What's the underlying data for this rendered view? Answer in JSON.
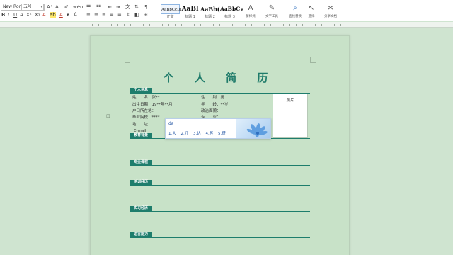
{
  "toolbar": {
    "font_name": "New Roma",
    "font_size": "五号",
    "styles": [
      {
        "preview": "AaBbCcDi",
        "label": "正文"
      },
      {
        "preview": "AaBl",
        "label": "标题 1"
      },
      {
        "preview": "AaBb(",
        "label": "标题 2"
      },
      {
        "preview": "AaBbC",
        "label": "标题 3"
      }
    ],
    "tools": [
      {
        "icon": "text-tools-icon",
        "glyph": "A",
        "label": "新样式"
      },
      {
        "icon": "text-toolbox-icon",
        "glyph": "✎",
        "label": "文字工具"
      },
      {
        "icon": "find-replace-icon",
        "glyph": "⌕",
        "label": "查找替换"
      },
      {
        "icon": "select-icon",
        "glyph": "↖",
        "label": "选择"
      },
      {
        "icon": "share-icon",
        "glyph": "⋈",
        "label": "分享文档"
      }
    ]
  },
  "document": {
    "title": "个 人 简 历",
    "photo_label": "照片",
    "sections": {
      "personal": "个人信息",
      "education": "教育背景",
      "courses": "专业课程",
      "awards": "培训经历",
      "practice": "实习经历",
      "language": "语言能力"
    },
    "fields": {
      "name": "姓　　名：张**",
      "gender": "性　　别：男",
      "birth": "出生日期：19**年**月",
      "age": "年　　龄：**岁",
      "hukou": "户口所在地：",
      "politics": "政治面貌：",
      "school": "毕业院校：****",
      "major": "专　　业：",
      "address": "地　　址：",
      "email": "E-mail："
    }
  },
  "ime": {
    "pinyin": "da",
    "candidates": [
      "1.大",
      "2.打",
      "3.达",
      "4.答",
      "5.搭"
    ],
    "pager": "‹ ›"
  },
  "colors": {
    "accent": "#1e7d6c",
    "page_bg": "#c8e2c8",
    "canvas_bg": "#cfe4d0"
  }
}
